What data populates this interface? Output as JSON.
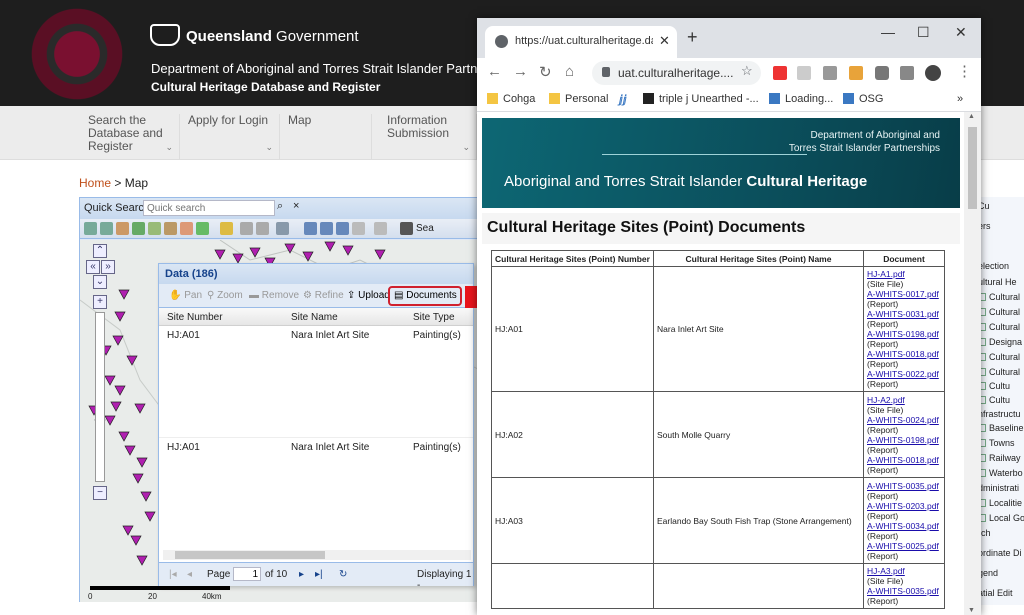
{
  "site": {
    "gov_bold": "Queensland",
    "gov_rest": " Government",
    "department": "Department of Aboriginal and Torres Strait Islander Partnerships",
    "app_title": "Cultural Heritage Database and Register",
    "nav": [
      {
        "label": "Search the Database and Register"
      },
      {
        "label": "Apply for Login"
      },
      {
        "label": "Map"
      },
      {
        "label": "Information Submission"
      }
    ],
    "breadcrumb_home": "Home",
    "breadcrumb_current": " > Map"
  },
  "mapapp": {
    "quick_search_label": "Quick Search:",
    "quick_search_placeholder": "Quick search",
    "toolbar_search_label": "Sea",
    "scale_labels": [
      "0",
      "20",
      "40km"
    ]
  },
  "datawin": {
    "title": "Data (186)",
    "tools": [
      "Pan",
      "Zoom",
      "Remove",
      "Refine",
      "Upload",
      "Documents"
    ],
    "columns": [
      "Site Number",
      "Site Name",
      "Site Type"
    ],
    "rows": [
      {
        "site_number": "HJ:A01",
        "site_name": "Nara Inlet Art Site",
        "site_type": "Painting(s)"
      },
      {
        "site_number": "HJ:A01",
        "site_name": "Nara Inlet Art Site",
        "site_type": "Painting(s)"
      }
    ],
    "pager": {
      "page_label": "Page",
      "page_value": "1",
      "of_label": "of 10",
      "displaying": "Displaying 1 -"
    }
  },
  "rightpanel": {
    "items": [
      "Cu",
      "ers",
      "election",
      "ultural He",
      "Cultural",
      "Cultural",
      "Cultural",
      "Designa",
      "Cultural",
      "Cultural",
      "Cultu",
      "Cultu",
      "nfrastructu",
      "Baseline",
      "Towns",
      "Railway",
      "Waterbo",
      "dministrati",
      "Localitie",
      "Local Go",
      "rch",
      "ordinate Di",
      "gend",
      "atial Edit"
    ]
  },
  "browser": {
    "tab_title": "https://uat.culturalheritage.datsip",
    "url": "uat.culturalheritage....",
    "bookmarks": [
      "Cohga",
      "Personal",
      "triple j Unearthed -...",
      "Loading...",
      "OSG"
    ],
    "overflow": "»"
  },
  "page": {
    "banner_dept_line1": "Department of Aboriginal and",
    "banner_dept_line2": "Torres Strait Islander Partnerships",
    "banner_title_prefix": "Aboriginal and Torres Strait Islander ",
    "banner_title_bold": "Cultural Heritage",
    "heading": "Cultural Heritage Sites (Point) Documents",
    "columns": [
      "Cultural Heritage Sites (Point) Number",
      "Cultural Heritage Sites (Point) Name",
      "Document"
    ],
    "rows": [
      {
        "number": "HJ:A01",
        "name": "Nara Inlet Art Site",
        "docs": [
          {
            "file": "HJ-A1.pdf",
            "type": "(Site File)"
          },
          {
            "file": "A-WHITS-0017.pdf",
            "type": "(Report)"
          },
          {
            "file": "A-WHITS-0031.pdf",
            "type": "(Report)"
          },
          {
            "file": "A-WHITS-0198.pdf",
            "type": "(Report)"
          },
          {
            "file": "A-WHITS-0018.pdf",
            "type": "(Report)"
          },
          {
            "file": "A-WHITS-0022.pdf",
            "type": "(Report)"
          }
        ]
      },
      {
        "number": "HJ:A02",
        "name": "South Molle Quarry",
        "docs": [
          {
            "file": "HJ-A2.pdf",
            "type": "(Site File)"
          },
          {
            "file": "A-WHITS-0024.pdf",
            "type": "(Report)"
          },
          {
            "file": "A-WHITS-0198.pdf",
            "type": "(Report)"
          },
          {
            "file": "A-WHITS-0018.pdf",
            "type": "(Report)"
          }
        ]
      },
      {
        "number": "HJ:A03",
        "name": "Earlando Bay South Fish Trap (Stone Arrangement)",
        "docs": [
          {
            "file": "A-WHITS-0035.pdf",
            "type": "(Report)"
          },
          {
            "file": "A-WHITS-0203.pdf",
            "type": "(Report)"
          },
          {
            "file": "A-WHITS-0034.pdf",
            "type": "(Report)"
          },
          {
            "file": "A-WHITS-0025.pdf",
            "type": "(Report)"
          }
        ]
      },
      {
        "number": "",
        "name": "",
        "docs": [
          {
            "file": "HJ-A3.pdf",
            "type": "(Site File)"
          },
          {
            "file": "A-WHITS-0035.pdf",
            "type": "(Report)"
          }
        ]
      }
    ]
  },
  "colors": {
    "qld_dark": "#1e1e1e",
    "accent_red": "#d0202e",
    "banner_teal": "#0d6774",
    "link": "#1a0dab"
  }
}
